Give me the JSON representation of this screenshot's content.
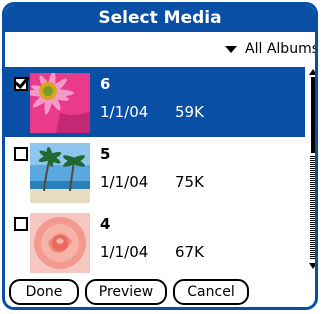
{
  "title": "Select Media",
  "album_filter": {
    "selected": "All Albums",
    "icon": "triangle-down-icon"
  },
  "items": [
    {
      "name": "6",
      "date": "1/1/04",
      "size": "59K",
      "checked": true,
      "selected": true
    },
    {
      "name": "5",
      "date": "1/1/04",
      "size": "75K",
      "checked": false,
      "selected": false
    },
    {
      "name": "4",
      "date": "1/1/04",
      "size": "67K",
      "checked": false,
      "selected": false
    }
  ],
  "buttons": {
    "done": "Done",
    "preview": "Preview",
    "cancel": "Cancel"
  },
  "colors": {
    "accent": "#0a4fa6",
    "background": "#ffffff",
    "text": "#000000"
  }
}
